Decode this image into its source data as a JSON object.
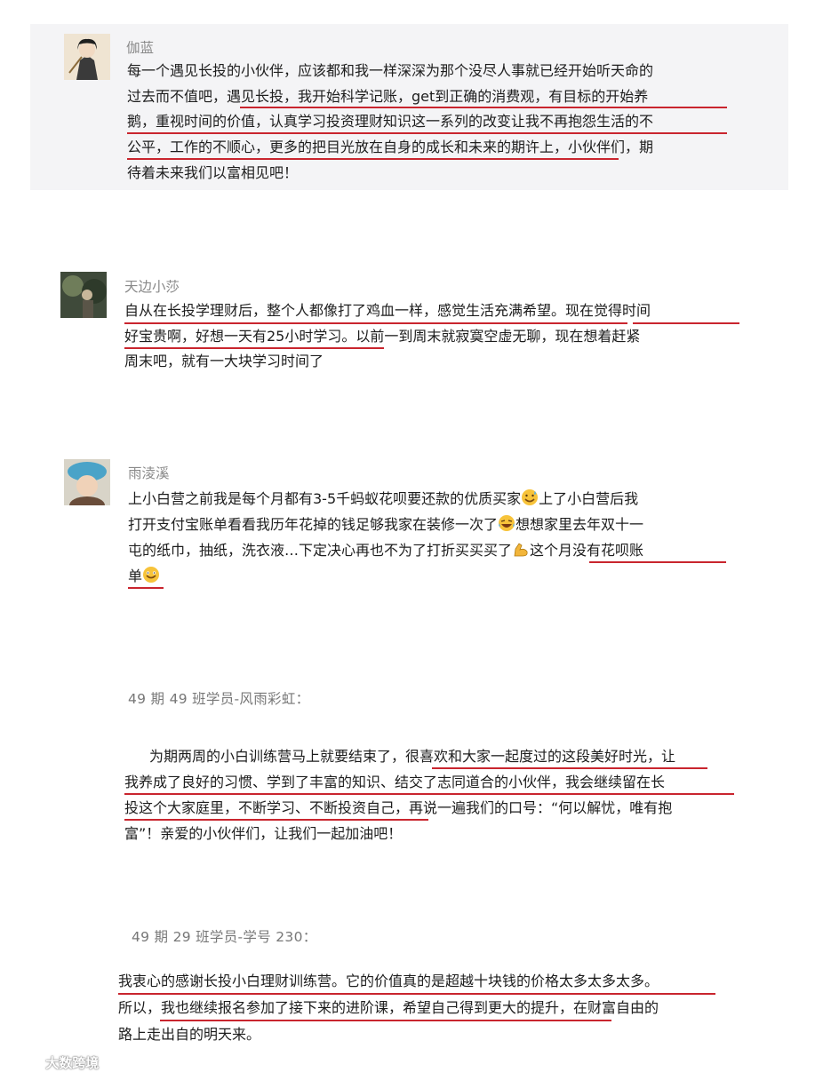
{
  "comments": [
    {
      "name": "伽蓝",
      "lines": [
        "每一个遇见长投的小伙伴，应该都和我一样深深为那个没尽人事就已经开始听天命的",
        "过去而不值吧，遇见长投，我开始科学记账，get到正确的消费观，有目标的开始养",
        "鹅，重视时间的价值，认真学习投资理财知识这一系列的改变让我不再抱怨生活的不",
        "公平，工作的不顺心，更多的把目光放在自身的成长和未来的期许上，小伙伴们，期",
        "待着未来我们以富相见吧！"
      ]
    },
    {
      "name": "天边小莎",
      "lines": [
        "自从在长投学理财后，整个人都像打了鸡血一样，感觉生活充满希望。现在觉得时间",
        "好宝贵啊，好想一天有25小时学习。以前一到周末就寂寞空虚无聊，现在想着赶紧",
        "周末吧，就有一大块学习时间了"
      ]
    },
    {
      "name": "雨淩溪",
      "line1a": "上小白营之前我是每个月都有3-5千蚂蚁花呗要还款的优质买家",
      "line1b": "上了小白营后我",
      "line2a": "打开支付宝账单看看我历年花掉的钱足够我家在装修一次了",
      "line2b": "想想家里去年双十一",
      "line3a": "屯的纸巾，抽纸，洗衣液…下定决心再也不为了打折买买买了",
      "line3b": "这个月没有花呗账",
      "line4a": "单",
      "emoji1": "sweat-smile-emoji",
      "emoji2": "laugh-cry-emoji",
      "emoji3": "flex-arm-emoji",
      "emoji4": "smile-emoji"
    }
  ],
  "posts": [
    {
      "label": "49 期 49 班学员-风雨彩虹：",
      "lines": [
        "为期两周的小白训练营马上就要结束了，很喜欢和大家一起度过的这段美好时光，让",
        "我养成了良好的习惯、学到了丰富的知识、结交了志同道合的小伙伴，我会继续留在长",
        "投这个大家庭里，不断学习、不断投资自己，再说一遍我们的口号：“何以解忧，唯有抱",
        "富”！亲爱的小伙伴们，让我们一起加油吧！"
      ]
    },
    {
      "label": "49 期 29 班学员-学号 230：",
      "lines": [
        "我衷心的感谢长投小白理财训练营。它的价值真的是超越十块钱的价格太多太多太多。",
        "所以，我也继续报名参加了接下来的进阶课，希望自己得到更大的提升，在财富自由的",
        "路上走出自的明天来。"
      ]
    }
  ],
  "watermark": "大数跨境",
  "colors": {
    "underline": "#c9252e",
    "card_bg": "#f4f4f6",
    "name": "#8a8a8a"
  }
}
